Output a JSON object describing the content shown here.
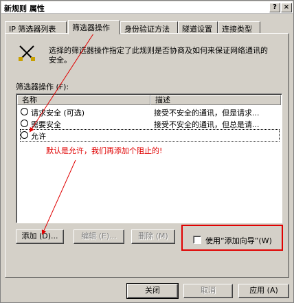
{
  "window": {
    "title": "新规则 属性",
    "help_label": "?",
    "close_label": "×"
  },
  "tabs": [
    {
      "label": "IP 筛选器列表"
    },
    {
      "label": "筛选器操作",
      "active": true
    },
    {
      "label": "身份验证方法"
    },
    {
      "label": "隧道设置"
    },
    {
      "label": "连接类型"
    }
  ],
  "panel": {
    "description": "选择的筛选器操作指定了此规则是否协商及如何来保证网络通讯的安全。",
    "section_label": "筛选器操作 (F):",
    "columns": [
      "名称",
      "描述"
    ],
    "rows": [
      {
        "name": "请求安全 (可选)",
        "desc": "接受不安全的通讯，但是请求..."
      },
      {
        "name": "需要安全",
        "desc": "接受不安全的通讯，但总是请..."
      },
      {
        "name": "允许",
        "desc": ""
      }
    ],
    "annotation": "默认是允许，我们再添加个阻止的!"
  },
  "buttons": {
    "add": "添加 (D)...",
    "edit": "编辑 (E)...",
    "remove": "删除 (M)",
    "wizard_label": "使用“添加向导”(W)",
    "close": "关闭",
    "cancel": "取消",
    "apply": "应用 (A)"
  },
  "colors": {
    "annotation_red": "#e00000",
    "dialog_bg": "#d4d0c8"
  }
}
